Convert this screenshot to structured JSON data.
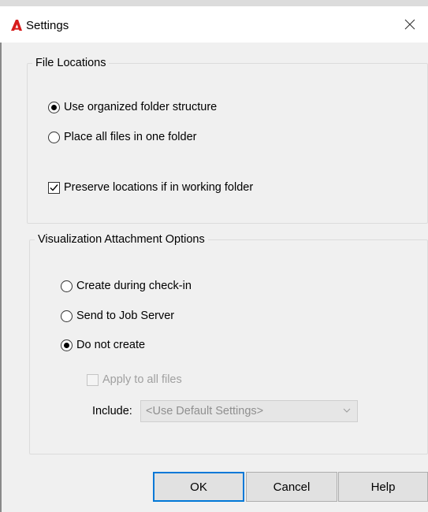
{
  "window": {
    "title": "Settings",
    "app_icon": "autodesk-a-icon",
    "close_icon": "close-icon"
  },
  "file_locations": {
    "legend": "File Locations",
    "options": [
      {
        "label": "Use organized folder structure",
        "selected": true
      },
      {
        "label": "Place all files in one folder",
        "selected": false
      }
    ],
    "preserve": {
      "label": "Preserve locations if in working folder",
      "checked": true
    }
  },
  "visualization": {
    "legend": "Visualization Attachment Options",
    "options": [
      {
        "label": "Create during check-in",
        "selected": false
      },
      {
        "label": "Send to Job Server",
        "selected": false
      },
      {
        "label": "Do not create",
        "selected": true
      }
    ],
    "apply_all": {
      "label": "Apply to all files",
      "checked": false,
      "enabled": false
    },
    "include": {
      "label": "Include:",
      "value": "<Use Default Settings>",
      "enabled": false
    }
  },
  "buttons": {
    "ok": "OK",
    "cancel": "Cancel",
    "help": "Help"
  },
  "colors": {
    "accent": "#0078d7",
    "icon_red": "#d71c1c",
    "dialog_bg": "#f0f0f0"
  }
}
